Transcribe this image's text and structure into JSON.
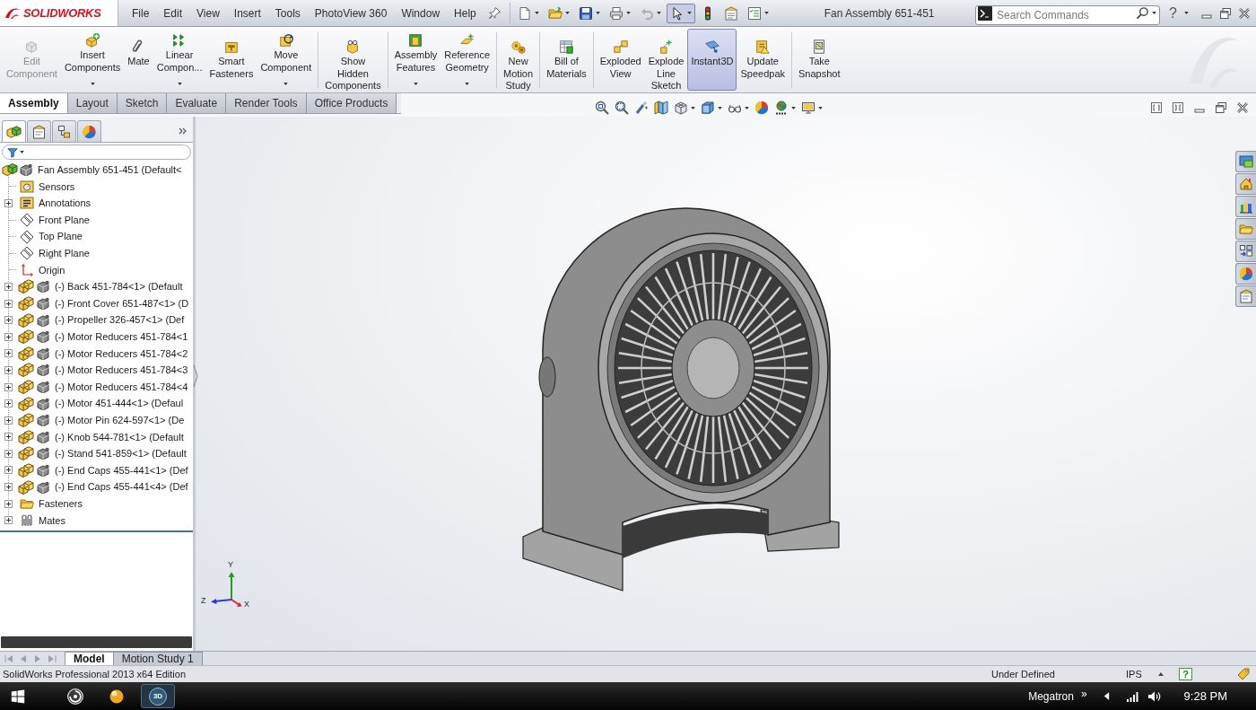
{
  "logo": {
    "text": "SOLIDWORKS"
  },
  "menu": [
    "File",
    "Edit",
    "View",
    "Insert",
    "Tools",
    "PhotoView 360",
    "Window",
    "Help"
  ],
  "window": {
    "title": "Fan Assembly 651-451"
  },
  "search": {
    "placeholder": "Search Commands"
  },
  "help": "?",
  "ribbon": {
    "groups": [
      [
        {
          "label": "Edit\nComponent",
          "disabled": true,
          "selected": false,
          "dropdown": false
        },
        {
          "label": "Insert\nComponents",
          "disabled": false,
          "selected": false,
          "dropdown": true
        },
        {
          "label": "Mate",
          "disabled": false,
          "selected": false,
          "dropdown": false
        },
        {
          "label": "Linear\nCompon...",
          "disabled": false,
          "selected": false,
          "dropdown": true
        },
        {
          "label": "Smart\nFasteners",
          "disabled": false,
          "selected": false,
          "dropdown": false
        },
        {
          "label": "Move\nComponent",
          "disabled": false,
          "selected": false,
          "dropdown": true
        }
      ],
      [
        {
          "label": "Show\nHidden\nComponents",
          "disabled": false,
          "selected": false,
          "dropdown": false
        }
      ],
      [
        {
          "label": "Assembly\nFeatures",
          "disabled": false,
          "selected": false,
          "dropdown": true
        },
        {
          "label": "Reference\nGeometry",
          "disabled": false,
          "selected": false,
          "dropdown": true
        }
      ],
      [
        {
          "label": "New\nMotion\nStudy",
          "disabled": false,
          "selected": false,
          "dropdown": false
        }
      ],
      [
        {
          "label": "Bill of\nMaterials",
          "disabled": false,
          "selected": false,
          "dropdown": false
        }
      ],
      [
        {
          "label": "Exploded\nView",
          "disabled": false,
          "selected": false,
          "dropdown": false
        },
        {
          "label": "Explode\nLine\nSketch",
          "disabled": false,
          "selected": false,
          "dropdown": false
        },
        {
          "label": "Instant3D",
          "disabled": false,
          "selected": true,
          "dropdown": false
        },
        {
          "label": "Update\nSpeedpak",
          "disabled": false,
          "selected": false,
          "dropdown": false
        }
      ],
      [
        {
          "label": "Take\nSnapshot",
          "disabled": false,
          "selected": false,
          "dropdown": false
        }
      ]
    ]
  },
  "command_tabs": [
    {
      "label": "Assembly",
      "selected": true
    },
    {
      "label": "Layout",
      "selected": false
    },
    {
      "label": "Sketch",
      "selected": false
    },
    {
      "label": "Evaluate",
      "selected": false
    },
    {
      "label": "Render Tools",
      "selected": false
    },
    {
      "label": "Office Products",
      "selected": false
    }
  ],
  "feature_tree": {
    "panel_tabs": [
      {
        "selected": true
      },
      {
        "selected": false
      },
      {
        "selected": false
      },
      {
        "selected": false
      }
    ],
    "root": {
      "label": "Fan Assembly 651-451 (Default<",
      "kind": "assembly",
      "children": [
        {
          "label": "Sensors",
          "kind": "sensors"
        },
        {
          "label": "Annotations",
          "kind": "annotations",
          "expanded": false
        },
        {
          "label": "Front Plane",
          "kind": "plane"
        },
        {
          "label": "Top Plane",
          "kind": "plane"
        },
        {
          "label": "Right Plane",
          "kind": "plane"
        },
        {
          "label": "Origin",
          "kind": "origin"
        },
        {
          "label": "(-) Back 451-784<1> (Default",
          "kind": "component",
          "expanded": false
        },
        {
          "label": "(-) Front Cover 651-487<1> (D",
          "kind": "component",
          "expanded": false
        },
        {
          "label": "(-) Propeller 326-457<1> (Def",
          "kind": "component",
          "expanded": false
        },
        {
          "label": "(-) Motor Reducers 451-784<1",
          "kind": "component",
          "expanded": false
        },
        {
          "label": "(-) Motor Reducers 451-784<2",
          "kind": "component",
          "expanded": false
        },
        {
          "label": "(-) Motor Reducers 451-784<3",
          "kind": "component",
          "expanded": false
        },
        {
          "label": "(-) Motor Reducers 451-784<4",
          "kind": "component",
          "expanded": false
        },
        {
          "label": "(-) Motor 451-444<1> (Defaul",
          "kind": "component",
          "expanded": false
        },
        {
          "label": "(-) Motor Pin 624-597<1> (De",
          "kind": "component",
          "expanded": false
        },
        {
          "label": "(-) Knob 544-781<1> (Default",
          "kind": "component",
          "expanded": false
        },
        {
          "label": "(-) Stand 541-859<1> (Default",
          "kind": "component",
          "expanded": false
        },
        {
          "label": "(-) End Caps 455-441<1> (Def",
          "kind": "component",
          "expanded": false
        },
        {
          "label": "(-) End Caps 455-441<4> (Def",
          "kind": "component",
          "expanded": false
        },
        {
          "label": "Fasteners",
          "kind": "folder",
          "expanded": false
        },
        {
          "label": "Mates",
          "kind": "mates",
          "expanded": false
        }
      ]
    }
  },
  "triad": [
    "Y",
    "Z",
    "X"
  ],
  "bottom_tabs": [
    {
      "label": "Model",
      "selected": true
    },
    {
      "label": "Motion Study 1",
      "selected": false
    }
  ],
  "status_bar": {
    "product": "SolidWorks Professional 2013 x64 Edition",
    "state": "Under Defined",
    "units": "IPS",
    "help": "?"
  },
  "taskbar": {
    "apps": [
      {
        "active": false
      },
      {
        "active": false
      },
      {
        "label": "3D",
        "active": true
      }
    ],
    "user": "Megatron",
    "overflow": "»",
    "clock": "9:28 PM"
  }
}
